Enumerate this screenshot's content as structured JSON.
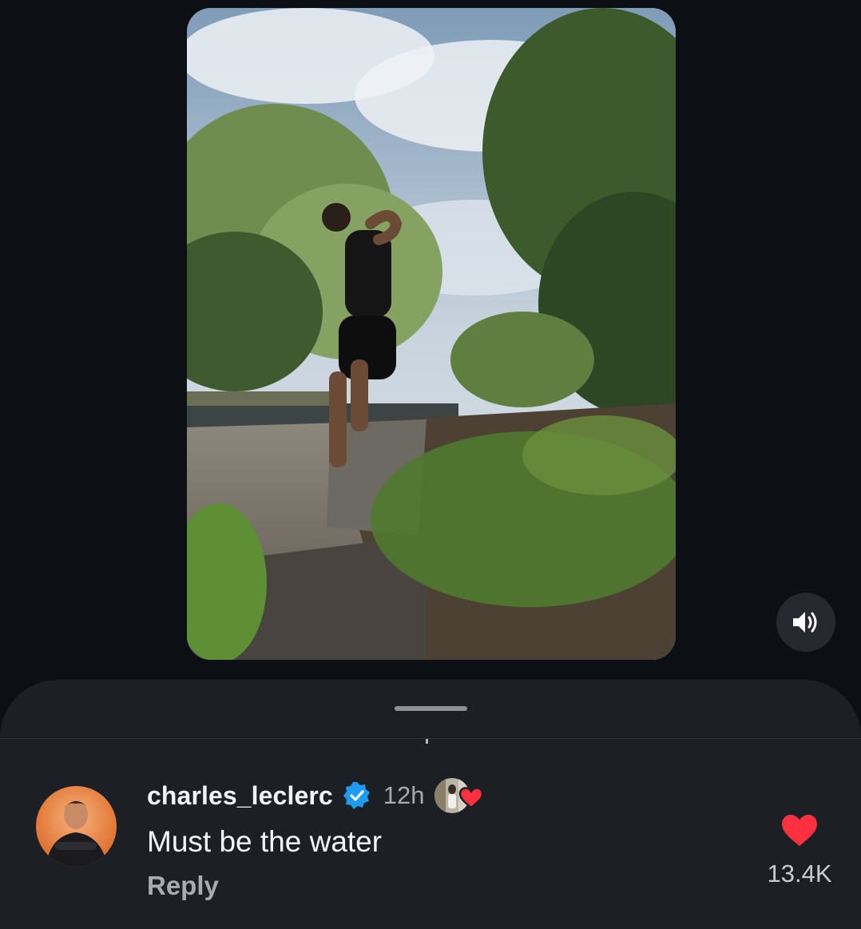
{
  "video": {
    "description_icon": "video-player",
    "sound_button_icon": "speaker-on-icon"
  },
  "comment": {
    "username": "charles_leclerc",
    "verified_icon": "verified-badge-icon",
    "timestamp": "12h",
    "liked_by_creator_icon": "heart-icon",
    "text": "Must be the water",
    "reply_label": "Reply",
    "like_icon": "heart-filled-icon",
    "like_count": "13.4K"
  },
  "colors": {
    "background": "#0c1014",
    "sheet": "#1c1f23",
    "verified_blue": "#1d9bf0",
    "heart_red": "#ff3040"
  }
}
